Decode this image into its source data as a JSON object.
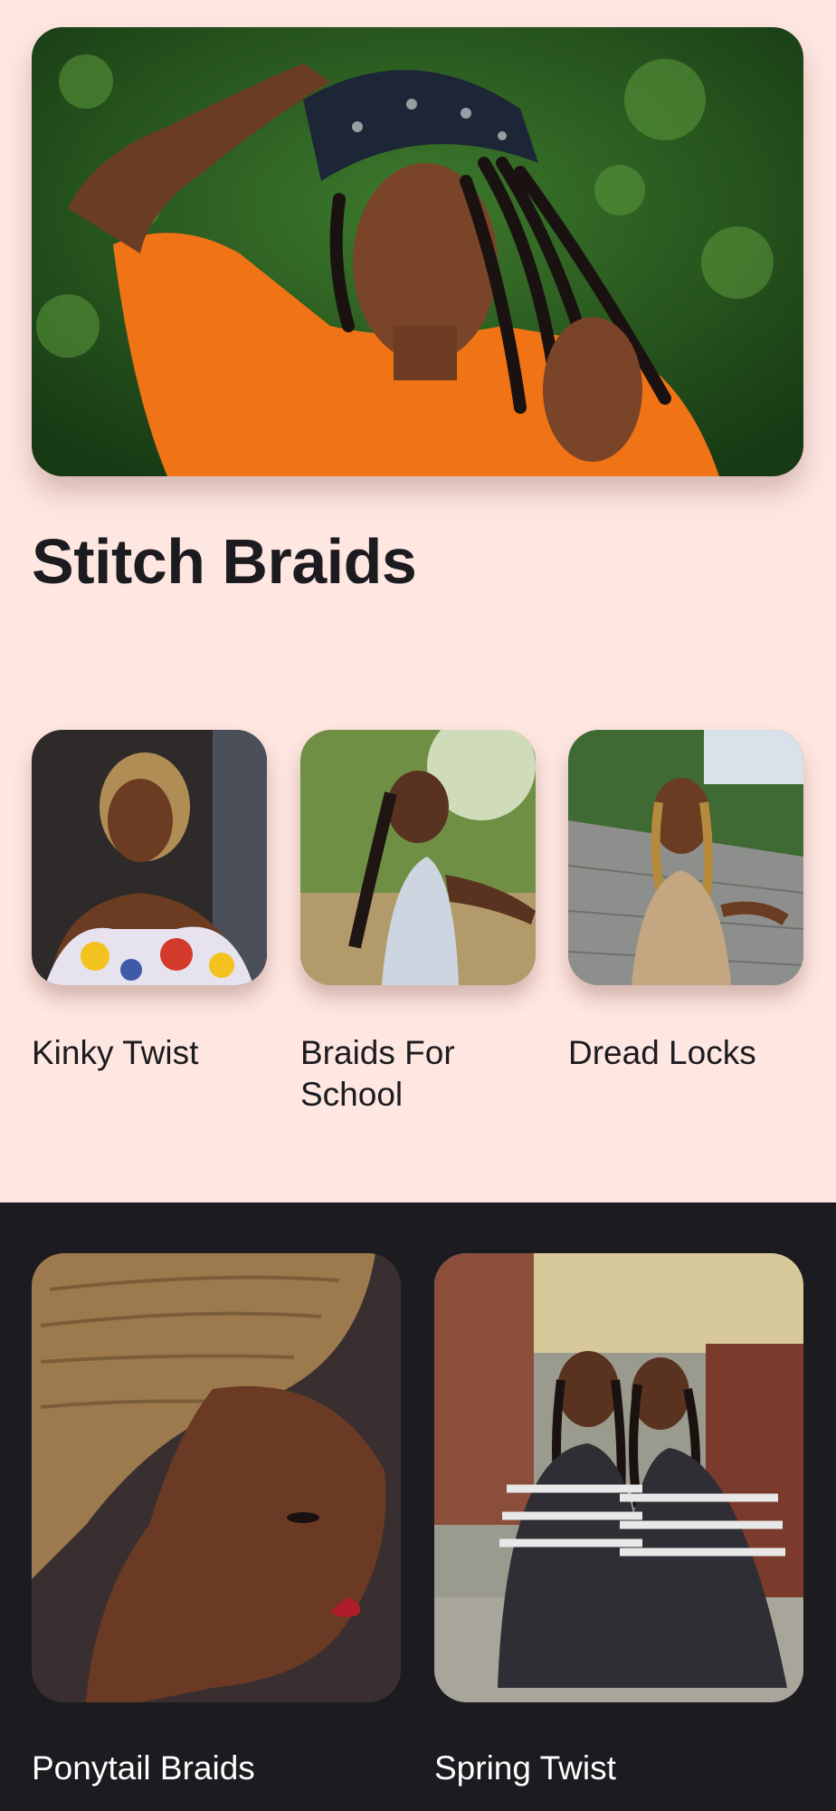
{
  "hero": {
    "image": "woman-with-box-braids-and-bandana-photo"
  },
  "section": {
    "title": "Stitch Braids"
  },
  "categories": [
    {
      "label": "Kinky Twist",
      "image": "kinky-twist-photo"
    },
    {
      "label": "Braids For School",
      "image": "braids-for-school-photo"
    },
    {
      "label": "Dread Locks",
      "image": "dread-locks-photo"
    }
  ],
  "featured": [
    {
      "label": "Ponytail Braids",
      "image": "ponytail-braids-photo"
    },
    {
      "label": "Spring Twist",
      "image": "spring-twist-photo"
    }
  ],
  "colors": {
    "background": "#fee6e1",
    "dark_section": "#1c1b1f",
    "title_text": "#1c1b1f",
    "light_text": "#ffffff"
  }
}
